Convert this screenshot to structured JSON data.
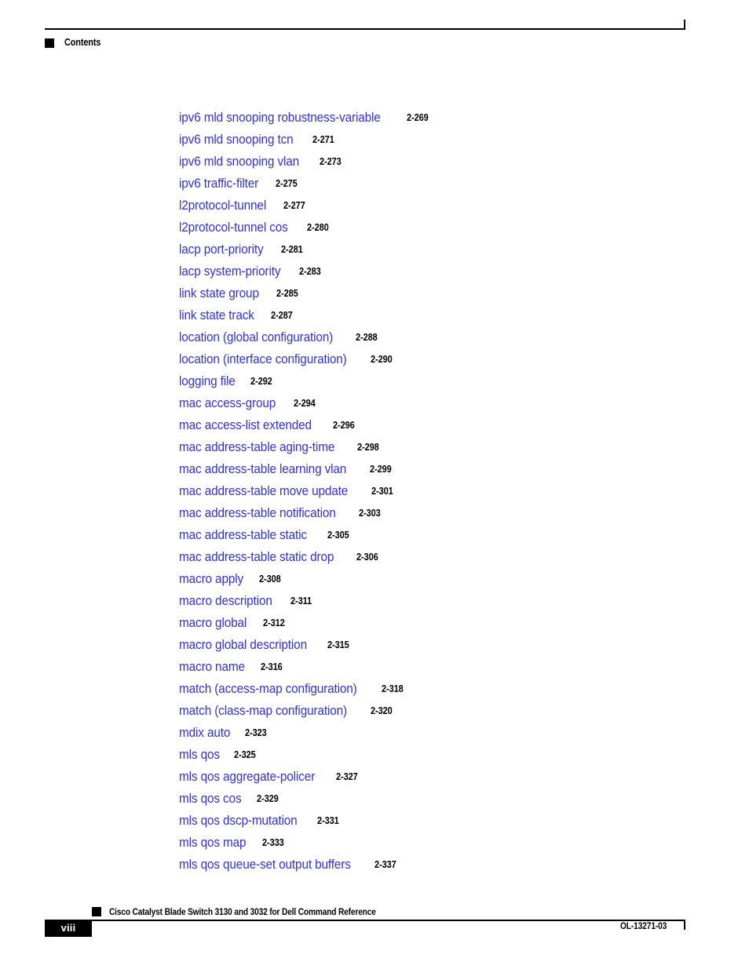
{
  "header": {
    "title": "Contents",
    "bullet_icon": "black-square-icon"
  },
  "toc": {
    "entries": [
      {
        "title": "ipv6 mld snooping robustness-variable",
        "page": "2-269"
      },
      {
        "title": "ipv6 mld snooping tcn",
        "page": "2-271"
      },
      {
        "title": "ipv6 mld snooping vlan",
        "page": "2-273"
      },
      {
        "title": "ipv6 traffic-filter",
        "page": "2-275"
      },
      {
        "title": "l2protocol-tunnel",
        "page": "2-277"
      },
      {
        "title": "l2protocol-tunnel cos",
        "page": "2-280"
      },
      {
        "title": "lacp port-priority",
        "page": "2-281"
      },
      {
        "title": "lacp system-priority",
        "page": "2-283"
      },
      {
        "title": "link state group",
        "page": "2-285"
      },
      {
        "title": "link state track",
        "page": "2-287"
      },
      {
        "title": "location (global configuration)",
        "page": "2-288"
      },
      {
        "title": "location (interface configuration)",
        "page": "2-290"
      },
      {
        "title": "logging file",
        "page": "2-292"
      },
      {
        "title": "mac access-group",
        "page": "2-294"
      },
      {
        "title": "mac access-list extended",
        "page": "2-296"
      },
      {
        "title": "mac address-table aging-time",
        "page": "2-298"
      },
      {
        "title": "mac address-table learning vlan",
        "page": "2-299"
      },
      {
        "title": "mac address-table move update",
        "page": "2-301"
      },
      {
        "title": "mac address-table notification",
        "page": "2-303"
      },
      {
        "title": "mac address-table static",
        "page": "2-305"
      },
      {
        "title": "mac address-table static drop",
        "page": "2-306"
      },
      {
        "title": "macro apply",
        "page": "2-308"
      },
      {
        "title": "macro description",
        "page": "2-311"
      },
      {
        "title": "macro global",
        "page": "2-312"
      },
      {
        "title": "macro global description",
        "page": "2-315"
      },
      {
        "title": "macro name",
        "page": "2-316"
      },
      {
        "title": "match (access-map configuration)",
        "page": "2-318"
      },
      {
        "title": "match (class-map configuration)",
        "page": "2-320"
      },
      {
        "title": "mdix auto",
        "page": "2-323"
      },
      {
        "title": "mls qos",
        "page": "2-325"
      },
      {
        "title": "mls qos aggregate-policer",
        "page": "2-327"
      },
      {
        "title": "mls qos cos",
        "page": "2-329"
      },
      {
        "title": "mls qos dscp-mutation",
        "page": "2-331"
      },
      {
        "title": "mls qos map",
        "page": "2-333"
      },
      {
        "title": "mls qos queue-set output buffers",
        "page": "2-337"
      }
    ]
  },
  "footer": {
    "book_title": "Cisco Catalyst Blade Switch 3130 and 3032 for Dell Command Reference",
    "page_number": "viii",
    "doc_id": "OL-13271-03",
    "bullet_icon": "black-square-icon"
  },
  "colors": {
    "link_blue": "#3333cc",
    "text_black": "#000000",
    "page_background": "#ffffff"
  }
}
